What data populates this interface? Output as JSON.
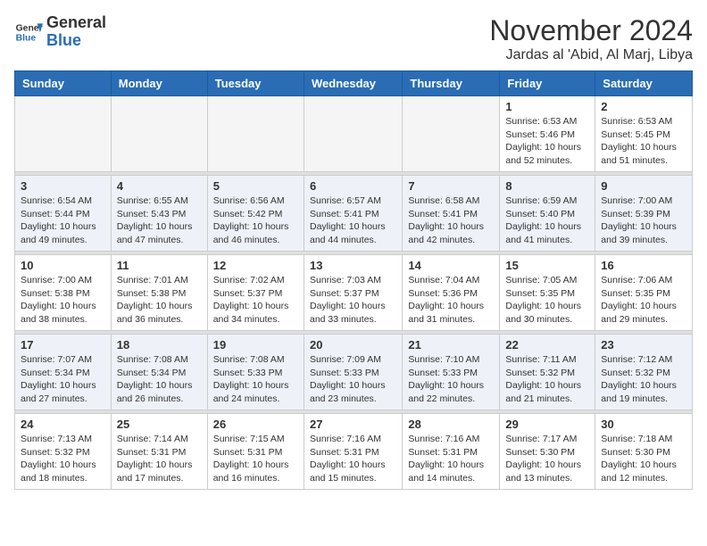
{
  "header": {
    "logo_general": "General",
    "logo_blue": "Blue",
    "month": "November 2024",
    "location": "Jardas al 'Abid, Al Marj, Libya"
  },
  "weekdays": [
    "Sunday",
    "Monday",
    "Tuesday",
    "Wednesday",
    "Thursday",
    "Friday",
    "Saturday"
  ],
  "weeks": [
    [
      {
        "day": "",
        "info": ""
      },
      {
        "day": "",
        "info": ""
      },
      {
        "day": "",
        "info": ""
      },
      {
        "day": "",
        "info": ""
      },
      {
        "day": "",
        "info": ""
      },
      {
        "day": "1",
        "info": "Sunrise: 6:53 AM\nSunset: 5:46 PM\nDaylight: 10 hours and 52 minutes."
      },
      {
        "day": "2",
        "info": "Sunrise: 6:53 AM\nSunset: 5:45 PM\nDaylight: 10 hours and 51 minutes."
      }
    ],
    [
      {
        "day": "3",
        "info": "Sunrise: 6:54 AM\nSunset: 5:44 PM\nDaylight: 10 hours and 49 minutes."
      },
      {
        "day": "4",
        "info": "Sunrise: 6:55 AM\nSunset: 5:43 PM\nDaylight: 10 hours and 47 minutes."
      },
      {
        "day": "5",
        "info": "Sunrise: 6:56 AM\nSunset: 5:42 PM\nDaylight: 10 hours and 46 minutes."
      },
      {
        "day": "6",
        "info": "Sunrise: 6:57 AM\nSunset: 5:41 PM\nDaylight: 10 hours and 44 minutes."
      },
      {
        "day": "7",
        "info": "Sunrise: 6:58 AM\nSunset: 5:41 PM\nDaylight: 10 hours and 42 minutes."
      },
      {
        "day": "8",
        "info": "Sunrise: 6:59 AM\nSunset: 5:40 PM\nDaylight: 10 hours and 41 minutes."
      },
      {
        "day": "9",
        "info": "Sunrise: 7:00 AM\nSunset: 5:39 PM\nDaylight: 10 hours and 39 minutes."
      }
    ],
    [
      {
        "day": "10",
        "info": "Sunrise: 7:00 AM\nSunset: 5:38 PM\nDaylight: 10 hours and 38 minutes."
      },
      {
        "day": "11",
        "info": "Sunrise: 7:01 AM\nSunset: 5:38 PM\nDaylight: 10 hours and 36 minutes."
      },
      {
        "day": "12",
        "info": "Sunrise: 7:02 AM\nSunset: 5:37 PM\nDaylight: 10 hours and 34 minutes."
      },
      {
        "day": "13",
        "info": "Sunrise: 7:03 AM\nSunset: 5:37 PM\nDaylight: 10 hours and 33 minutes."
      },
      {
        "day": "14",
        "info": "Sunrise: 7:04 AM\nSunset: 5:36 PM\nDaylight: 10 hours and 31 minutes."
      },
      {
        "day": "15",
        "info": "Sunrise: 7:05 AM\nSunset: 5:35 PM\nDaylight: 10 hours and 30 minutes."
      },
      {
        "day": "16",
        "info": "Sunrise: 7:06 AM\nSunset: 5:35 PM\nDaylight: 10 hours and 29 minutes."
      }
    ],
    [
      {
        "day": "17",
        "info": "Sunrise: 7:07 AM\nSunset: 5:34 PM\nDaylight: 10 hours and 27 minutes."
      },
      {
        "day": "18",
        "info": "Sunrise: 7:08 AM\nSunset: 5:34 PM\nDaylight: 10 hours and 26 minutes."
      },
      {
        "day": "19",
        "info": "Sunrise: 7:08 AM\nSunset: 5:33 PM\nDaylight: 10 hours and 24 minutes."
      },
      {
        "day": "20",
        "info": "Sunrise: 7:09 AM\nSunset: 5:33 PM\nDaylight: 10 hours and 23 minutes."
      },
      {
        "day": "21",
        "info": "Sunrise: 7:10 AM\nSunset: 5:33 PM\nDaylight: 10 hours and 22 minutes."
      },
      {
        "day": "22",
        "info": "Sunrise: 7:11 AM\nSunset: 5:32 PM\nDaylight: 10 hours and 21 minutes."
      },
      {
        "day": "23",
        "info": "Sunrise: 7:12 AM\nSunset: 5:32 PM\nDaylight: 10 hours and 19 minutes."
      }
    ],
    [
      {
        "day": "24",
        "info": "Sunrise: 7:13 AM\nSunset: 5:32 PM\nDaylight: 10 hours and 18 minutes."
      },
      {
        "day": "25",
        "info": "Sunrise: 7:14 AM\nSunset: 5:31 PM\nDaylight: 10 hours and 17 minutes."
      },
      {
        "day": "26",
        "info": "Sunrise: 7:15 AM\nSunset: 5:31 PM\nDaylight: 10 hours and 16 minutes."
      },
      {
        "day": "27",
        "info": "Sunrise: 7:16 AM\nSunset: 5:31 PM\nDaylight: 10 hours and 15 minutes."
      },
      {
        "day": "28",
        "info": "Sunrise: 7:16 AM\nSunset: 5:31 PM\nDaylight: 10 hours and 14 minutes."
      },
      {
        "day": "29",
        "info": "Sunrise: 7:17 AM\nSunset: 5:30 PM\nDaylight: 10 hours and 13 minutes."
      },
      {
        "day": "30",
        "info": "Sunrise: 7:18 AM\nSunset: 5:30 PM\nDaylight: 10 hours and 12 minutes."
      }
    ]
  ]
}
